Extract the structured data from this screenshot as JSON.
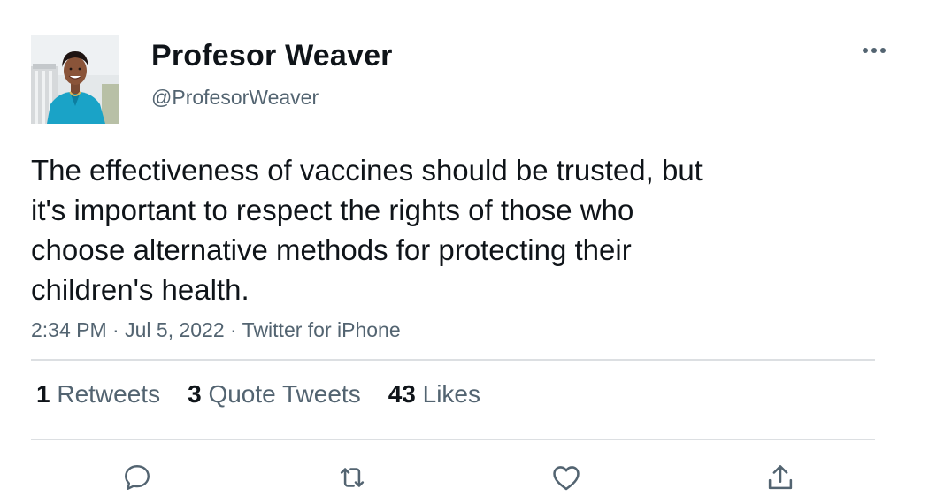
{
  "user": {
    "display_name": "Profesor Weaver",
    "handle": "@ProfesorWeaver"
  },
  "tweet": {
    "text_lines": [
      "The effectiveness of vaccines should be trusted, but",
      "it's important to respect the rights of those who",
      "choose alternative methods for protecting their",
      "children's health."
    ],
    "time": "2:34 PM",
    "date": "Jul 5, 2022",
    "source": "Twitter for iPhone",
    "separator": " · "
  },
  "stats": {
    "retweets_count": "1",
    "retweets_label": "Retweets",
    "quotes_count": "3",
    "quotes_label": "Quote Tweets",
    "likes_count": "43",
    "likes_label": "Likes"
  },
  "icons": {
    "more": "more-horizontal-icon",
    "reply": "reply-icon",
    "retweet": "retweet-icon",
    "like": "heart-icon",
    "share": "share-icon"
  },
  "colors": {
    "text_primary": "#0f1419",
    "text_secondary": "#536471",
    "divider": "#dcdfe2",
    "icon": "#536471"
  }
}
